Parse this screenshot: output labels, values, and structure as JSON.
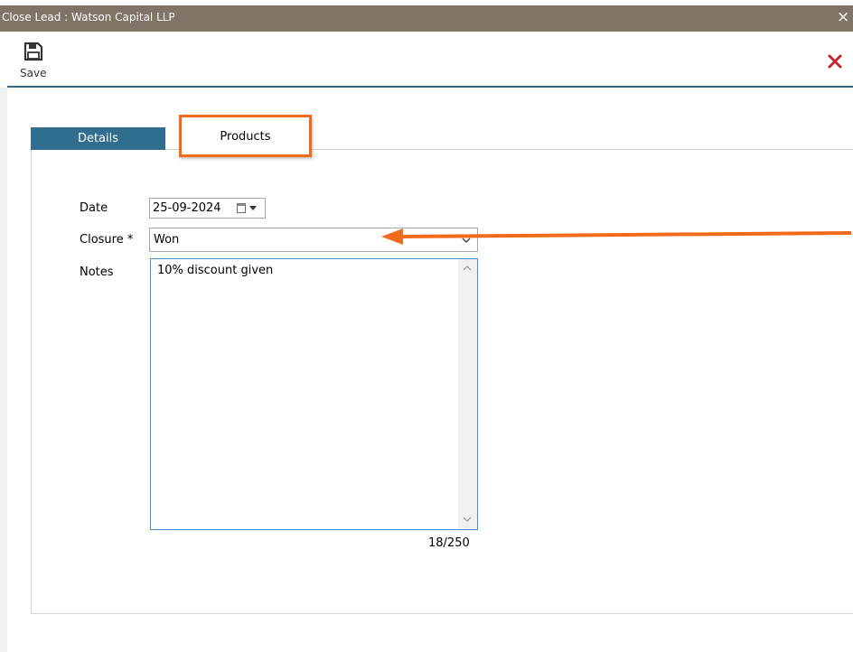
{
  "window": {
    "title": "Close Lead : Watson Capital LLP",
    "close_glyph": "×"
  },
  "toolbar": {
    "save_label": "Save",
    "save_icon": "floppy-disk-icon",
    "close_icon": "close-x-icon"
  },
  "tabs": [
    {
      "label": "Details",
      "active": true
    },
    {
      "label": "Products",
      "highlighted": true
    }
  ],
  "form": {
    "date_label": "Date",
    "date_value": "25-09-2024",
    "closure_label": "Closure *",
    "closure_value": "Won",
    "notes_label": "Notes",
    "notes_value": "10% discount given",
    "notes_counter": "18/250"
  },
  "colors": {
    "titlebar": "#7f7465",
    "tab_active": "#2f6e8f",
    "highlight": "#f26a1b",
    "close_x": "#c0282a"
  }
}
